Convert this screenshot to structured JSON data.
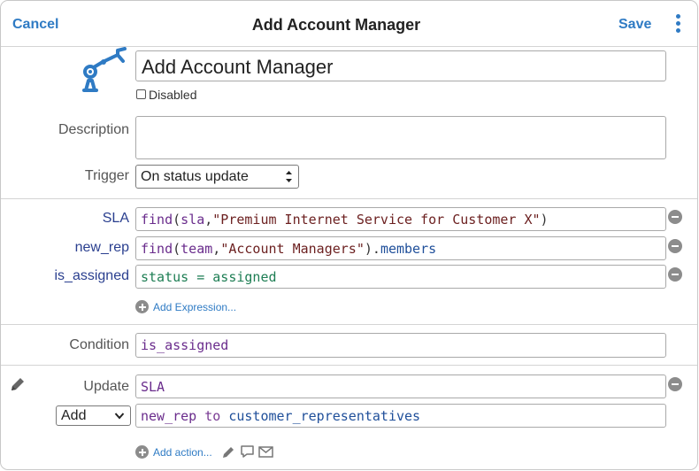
{
  "header": {
    "cancel_label": "Cancel",
    "title": "Add Account Manager",
    "save_label": "Save"
  },
  "form": {
    "name_value": "Add Account Manager",
    "disabled_label": "Disabled",
    "disabled_checked": false,
    "description_label": "Description",
    "description_value": "",
    "trigger_label": "Trigger",
    "trigger_value": "On status update"
  },
  "expressions": [
    {
      "label": "SLA",
      "tokens": [
        {
          "text": "find",
          "cls": "fn"
        },
        {
          "text": "(",
          "cls": "plain"
        },
        {
          "text": "sla",
          "cls": "fn"
        },
        {
          "text": ",",
          "cls": "plain"
        },
        {
          "text": "\"Premium Internet Service for Customer X\"",
          "cls": "str"
        },
        {
          "text": ")",
          "cls": "plain"
        }
      ]
    },
    {
      "label": "new_rep",
      "tokens": [
        {
          "text": "find",
          "cls": "fn"
        },
        {
          "text": "(",
          "cls": "plain"
        },
        {
          "text": "team",
          "cls": "fn"
        },
        {
          "text": ",",
          "cls": "plain"
        },
        {
          "text": "\"Account Managers\"",
          "cls": "str"
        },
        {
          "text": ")",
          "cls": "plain"
        },
        {
          "text": ".",
          "cls": "plain"
        },
        {
          "text": "members",
          "cls": "prop"
        }
      ]
    },
    {
      "label": "is_assigned",
      "tokens": [
        {
          "text": "status",
          "cls": "grn"
        },
        {
          "text": " = ",
          "cls": "grn"
        },
        {
          "text": "assigned",
          "cls": "grn"
        }
      ]
    }
  ],
  "add_expression_label": "Add Expression...",
  "condition": {
    "label": "Condition",
    "value": "is_assigned"
  },
  "update": {
    "label": "Update",
    "value": "SLA",
    "action_value": "Add",
    "action_expression": [
      {
        "text": "new_rep",
        "cls": "fn"
      },
      {
        "text": " to ",
        "cls": "kw"
      },
      {
        "text": "customer_representatives",
        "cls": "prop"
      }
    ]
  },
  "add_action_label": "Add action...",
  "colors": {
    "accent": "#2f7bc4",
    "function": "#6a2c8c",
    "string": "#6b1f1f",
    "property": "#1f4f9a",
    "status": "#1e7e54"
  },
  "icons": [
    "robot-arm-icon",
    "more-vertical-icon",
    "remove-circle-icon",
    "add-circle-icon",
    "pencil-icon",
    "comment-icon",
    "mail-icon",
    "chevron-down-icon"
  ]
}
